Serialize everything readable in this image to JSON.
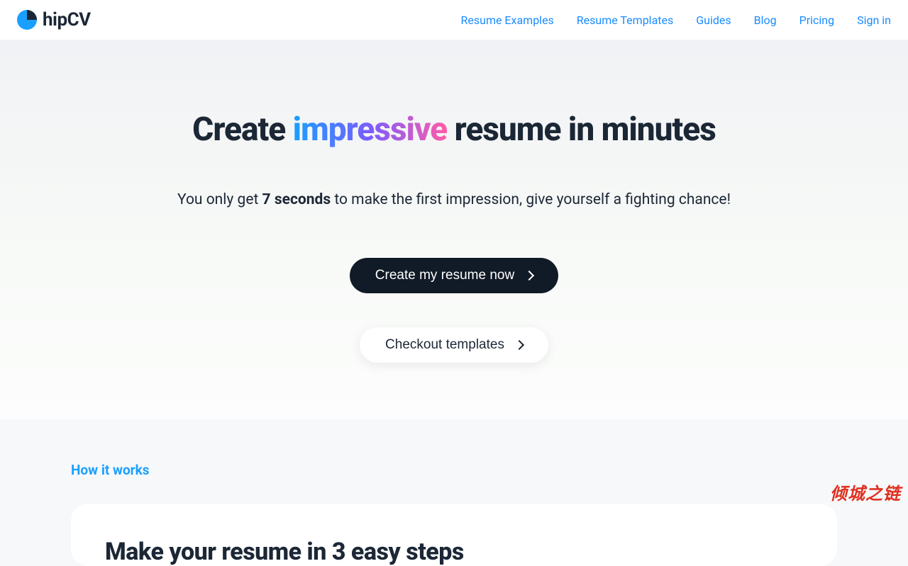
{
  "header": {
    "logo_text": "hipCV",
    "nav": [
      "Resume Examples",
      "Resume Templates",
      "Guides",
      "Blog",
      "Pricing",
      "Sign in"
    ]
  },
  "hero": {
    "title_pre": "Create ",
    "title_highlight": "impressive",
    "title_post": " resume in minutes",
    "subtitle_pre": "You only get ",
    "subtitle_bold": "7 seconds",
    "subtitle_post": " to make the first impression, give yourself a fighting chance!",
    "cta_primary": "Create my resume now",
    "cta_secondary": "Checkout templates"
  },
  "section2": {
    "label": "How it works",
    "card_title": "Make your resume in 3 easy steps"
  },
  "watermark": "倾城之链"
}
